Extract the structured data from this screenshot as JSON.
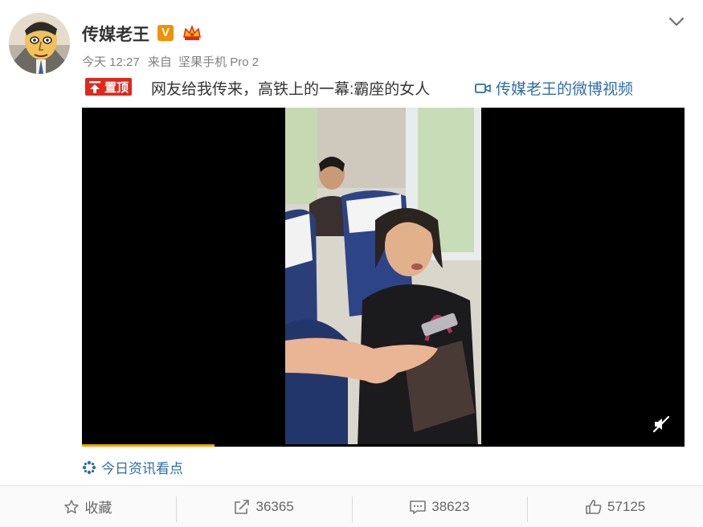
{
  "post": {
    "author": "传媒老王",
    "time": "今天 12:27",
    "from_prefix": "来自",
    "device": "坚果手机 Pro 2",
    "pin_label": "置顶",
    "text": "网友给我传来，高铁上的一幕:霸座的女人",
    "video_link": "传媒老王的微博视频",
    "topic": "今日资讯看点",
    "video_progress": 0.22
  },
  "actions": {
    "favorite": "收藏",
    "repost": "36365",
    "comment": "38623",
    "like": "57125"
  },
  "colors": {
    "pin_red": "#e0271b",
    "link_blue": "#2f6ea8",
    "verified_orange": "#f29100",
    "progress_orange": "#f7a200"
  },
  "icons": [
    "chevron-down-icon",
    "verified-v-icon",
    "crown-icon",
    "pin-icon",
    "video-camera-icon",
    "mute-icon",
    "topic-icon",
    "star-icon",
    "share-icon",
    "comment-icon",
    "thumbs-up-icon"
  ]
}
